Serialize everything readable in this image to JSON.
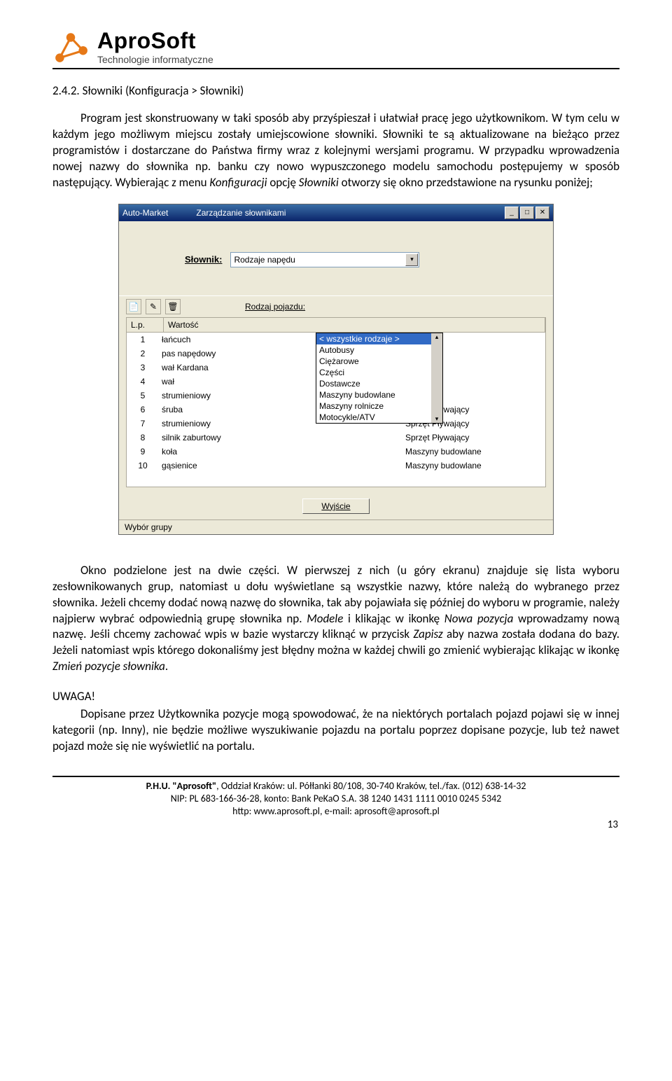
{
  "header": {
    "logo_title": "AproSoft",
    "logo_sub": "Technologie informatyczne"
  },
  "section": {
    "number_title": "2.4.2.  Słowniki (Konfiguracja > Słowniki)"
  },
  "paragraphs": {
    "p1": "Program jest skonstruowany w taki sposób aby przyśpieszał i ułatwiał pracę jego użytkownikom. W tym celu w każdym jego możliwym miejscu zostały umiejscowione słowniki. Słowniki te są aktualizowane na bieżąco przez programistów i dostarczane do Państwa firmy wraz z kolejnymi wersjami programu. W przypadku wprowadzenia nowej nazwy do słownika np. banku czy nowo wypuszczonego modelu samochodu postępujemy w sposób następujący. Wybierając z menu ",
    "p1_i1": "Konfiguracji",
    "p1_mid": " opcję ",
    "p1_i2": "Słowniki",
    "p1_end": " otworzy się okno przedstawione na rysunku poniżej;",
    "p2a": "Okno podzielone jest na dwie części. W pierwszej z nich (u góry ekranu) znajduje się lista wyboru zesłownikowanych grup, natomiast u dołu wyświetlane są wszystkie nazwy, które należą do wybranego przez słownika. Jeżeli chcemy dodać nową nazwę do słownika, tak aby pojawiała się później do wyboru w programie, należy najpierw wybrać odpowiednią grupę słownika np. ",
    "p2_i1": "Modele",
    "p2_mid1": " i klikając w ikonkę ",
    "p2_i2": "Nowa pozycja",
    "p2_mid2": " wprowadzamy nową nazwę. Jeśli chcemy zachować wpis w bazie wystarczy kliknąć w przycisk ",
    "p2_i3": "Zapisz",
    "p2_mid3": " aby nazwa została dodana do bazy. Jeżeli natomiast wpis którego dokonaliśmy jest błędny można w każdej chwili go zmienić wybierając  klikając w ikonkę ",
    "p2_i4": "Zmień pozycje słownika",
    "p2_end": ".",
    "uwaga": "UWAGA!",
    "p3": "Dopisane przez Użytkownika pozycje mogą spowodować, że na niektórych portalach pojazd pojawi się w innej kategorii (np. Inny), nie będzie możliwe wyszukiwanie pojazdu na portalu poprzez dopisane pozycje, lub też nawet pojazd może się nie wyświetlić na portalu."
  },
  "app": {
    "title_left": "Auto-Market",
    "title_right": "Zarządzanie słownikami",
    "slownik_label": "Słownik:",
    "slownik_value": "Rodzaje napędu",
    "rodzaj_label": "Rodzaj pojazdu:",
    "col_lp": "L.p.",
    "col_wart": "Wartość",
    "rows": [
      {
        "lp": "1",
        "w": "łańcuch",
        "c": ""
      },
      {
        "lp": "2",
        "w": "pas napędowy",
        "c": ""
      },
      {
        "lp": "3",
        "w": "wał Kardana",
        "c": ""
      },
      {
        "lp": "4",
        "w": "wał",
        "c": ""
      },
      {
        "lp": "5",
        "w": "strumieniowy",
        "c": ""
      },
      {
        "lp": "6",
        "w": "śruba",
        "c": "Sprzęt Pływający"
      },
      {
        "lp": "7",
        "w": "strumieniowy",
        "c": "Sprzęt Pływający"
      },
      {
        "lp": "8",
        "w": "silnik zaburtowy",
        "c": "Sprzęt Pływający"
      },
      {
        "lp": "9",
        "w": "koła",
        "c": "Maszyny budowlane"
      },
      {
        "lp": "10",
        "w": "gąsienice",
        "c": "Maszyny budowlane"
      }
    ],
    "dropdown": [
      "< wszystkie rodzaje >",
      "Autobusy",
      "Ciężarowe",
      "Części",
      "Dostawcze",
      "Maszyny budowlane",
      "Maszyny rolnicze",
      "Motocykle/ATV"
    ],
    "exit_btn": "Wyjście",
    "status": "Wybór grupy"
  },
  "footer": {
    "l1a": "P.H.U. \"Aprosoft\"",
    "l1b": ", Oddział Kraków: ul. Półłanki 80/108, 30-740 Kraków, tel./fax. (012) 638-14-32",
    "l2": "NIP: PL 683-166-36-28, konto: Bank PeKaO S.A. 38 1240 1431 1111 0010 0245 5342",
    "l3": "http: www.aprosoft.pl,  e-mail: aprosoft@aprosoft.pl",
    "page": "13"
  }
}
